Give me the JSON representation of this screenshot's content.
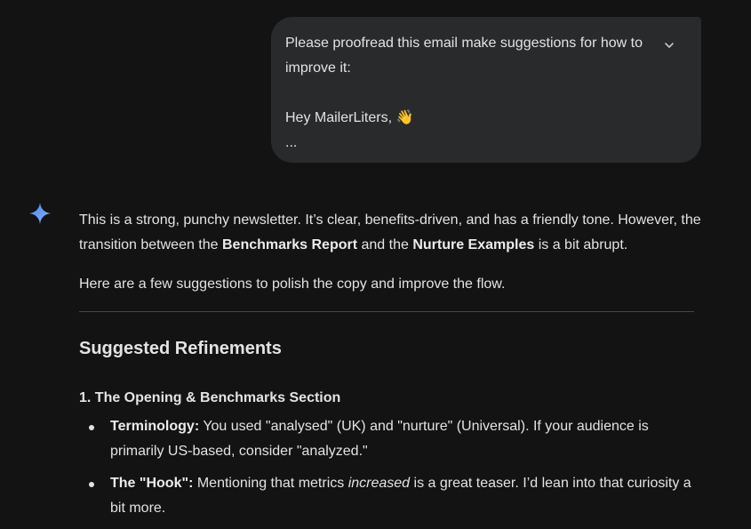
{
  "user_message": {
    "line1": "Please proofread this email make suggestions for how to improve it:",
    "greeting": "Hey MailerLiters,",
    "wave_emoji": "👋",
    "ellipsis": "...",
    "expand_icon": "chevron-down-icon"
  },
  "assistant": {
    "avatar_icon": "gemini-spark-icon",
    "accent_colors": [
      "#4285f4",
      "#8ab4f8"
    ],
    "intro": {
      "a": "This is a strong, punchy newsletter. It’s clear, benefits-driven, and has a friendly tone. However, the transition between the ",
      "b": "Benchmarks Report",
      "c": " and the ",
      "d": "Nurture Examples",
      "e": " is a bit abrupt."
    },
    "subintro": "Here are a few suggestions to polish the copy and improve the flow.",
    "heading": "Suggested Refinements",
    "section1": {
      "title": "1. The Opening & Benchmarks Section",
      "bullets": [
        {
          "label": "Terminology:",
          "text": " You used \"analysed\" (UK) and \"nurture\" (Universal). If your audience is primarily US-based, consider \"analyzed.\""
        },
        {
          "label": "The \"Hook\":",
          "pre": " Mentioning that metrics ",
          "em": "increased",
          "post": " is a great teaser. I’d lean into that curiosity a bit more."
        }
      ]
    }
  }
}
